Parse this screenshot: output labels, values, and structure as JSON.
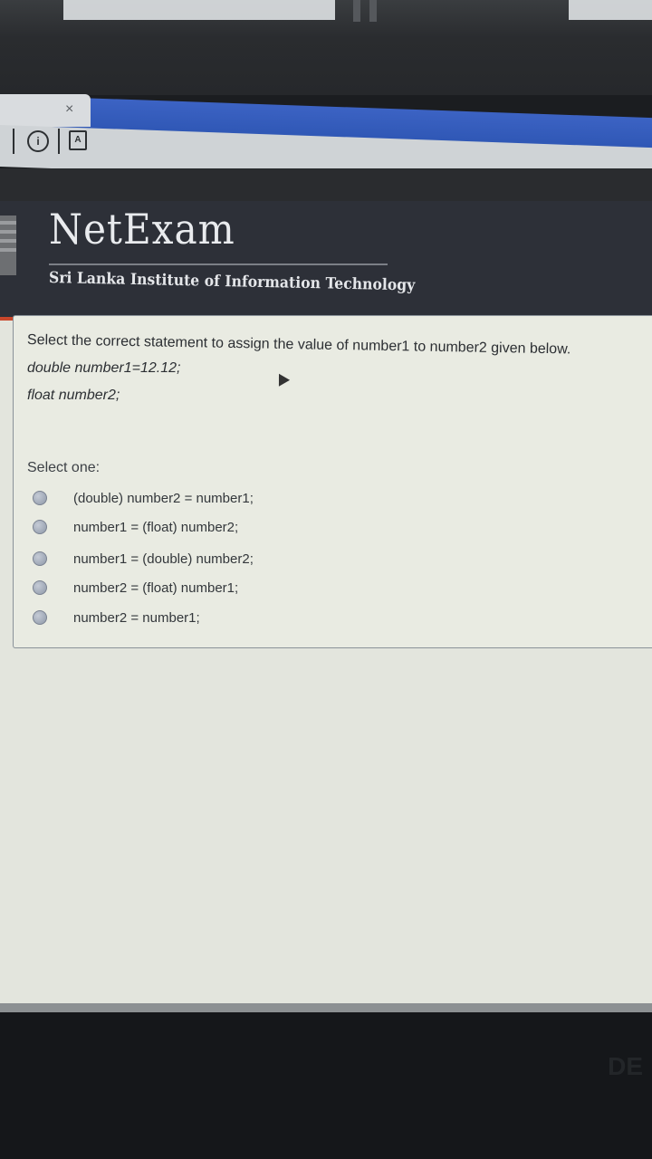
{
  "browser": {
    "tab_close_glyph": "×",
    "toolbar_icons": [
      "info-icon",
      "pdf-icon"
    ]
  },
  "site": {
    "brand": "NetExam",
    "institute": "Sri Lanka Institute of Information Technology"
  },
  "question": {
    "text": "Select the correct statement to assign the value of number1 to number2 given below.",
    "code_line_1": "double number1=12.12;",
    "code_line_2": "float number2;",
    "select_prompt": "Select one:",
    "options": [
      "(double) number2 = number1;",
      "number1 = (float) number2;",
      "number1 = (double) number2;",
      "number2 = (float) number1;",
      "number2 = number1;"
    ]
  },
  "bezel": {
    "logo": "DE"
  },
  "colors": {
    "header": "#2d3038",
    "accent": "#c9472b",
    "tab_strip": "#3c63c4"
  }
}
